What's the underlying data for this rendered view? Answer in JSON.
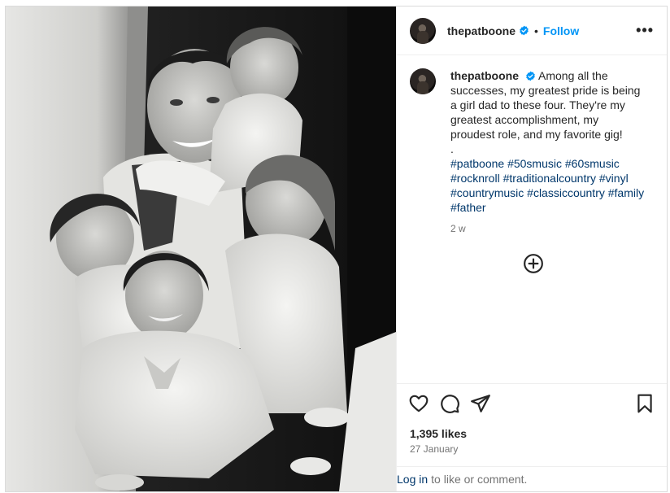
{
  "post": {
    "username": "thepatboone",
    "follow_label": "Follow",
    "separator": "•",
    "more_label": "•••",
    "caption": "Among all the successes, my greatest pride is being a girl dad to these four. They're my greatest accomplishment, my proudest role, and my favorite gig!",
    "caption_break": ".",
    "hashtags": [
      "#patboone",
      "#50smusic",
      "#60smusic",
      "#rocknroll",
      "#traditionalcountry",
      "#vinyl",
      "#countrymusic",
      "#classiccountry",
      "#family",
      "#father"
    ],
    "relative_time": "2 w",
    "likes": "1,395 likes",
    "date": "27 January"
  },
  "login_prompt": {
    "link": "Log in",
    "rest": "to like or comment."
  },
  "icons": {
    "verified": "verified-badge-icon",
    "more": "more-options-icon",
    "add_comment": "add-circle-icon",
    "like": "heart-icon",
    "comment": "comment-icon",
    "share": "share-icon",
    "save": "bookmark-icon"
  },
  "colors": {
    "accent": "#0095f6",
    "hashtag": "#00376b",
    "muted": "#737373"
  }
}
